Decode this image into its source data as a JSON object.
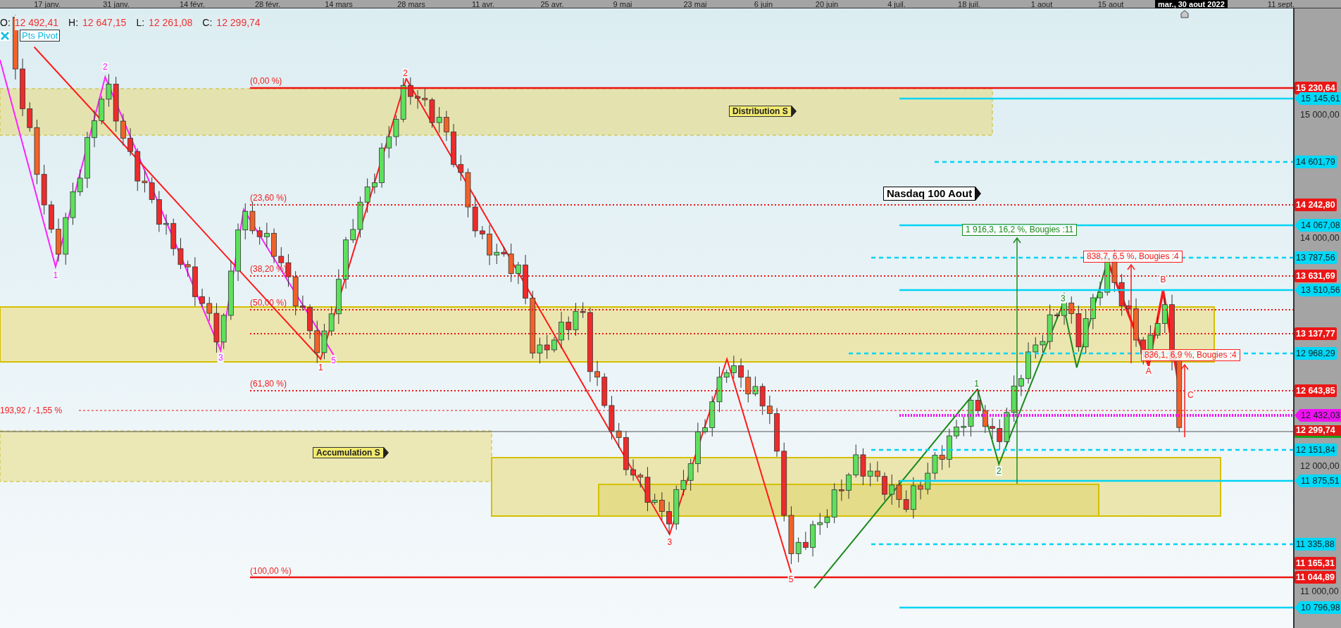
{
  "date_axis": {
    "labels": [
      "17 janv.",
      "31 janv.",
      "14 févr.",
      "28 févr.",
      "14 mars",
      "28 mars",
      "11 avr.",
      "25 avr.",
      "9 mai",
      "23 mai",
      "6 juin",
      "20 juin",
      "4 juil.",
      "18 juil.",
      "1 aout",
      "15 aout",
      "11 sept."
    ],
    "cursor_date": "mar., 30 aout 2022"
  },
  "legend": [
    {
      "key": "O:",
      "value": "12 492,41"
    },
    {
      "key": "H:",
      "value": "12 647,15"
    },
    {
      "key": "L:",
      "value": "12 261,08"
    },
    {
      "key": "C:",
      "value": "12 299,74"
    }
  ],
  "indicator": {
    "label": "Pts Pivot"
  },
  "chart_title": "Nasdaq 100 Aout",
  "zones": [
    {
      "label": "Distribution S"
    },
    {
      "label": "Accumulation S"
    }
  ],
  "fib_levels": [
    "(0,00 %)",
    "(23,60 %)",
    "(38,20 %)",
    "(50,00 %)",
    "(61,80 %)",
    "(100,00 %)"
  ],
  "range_label": "193,92 / -1,55 %",
  "waves": [
    {
      "color": "#ff20ff",
      "labels": [
        "1",
        "2",
        "3",
        "5"
      ]
    },
    {
      "color": "#ff1a1a",
      "labels": [
        "1",
        "2",
        "3",
        "5"
      ]
    },
    {
      "color": "#1a8a1a",
      "labels": [
        "1",
        "2",
        "3"
      ]
    },
    {
      "color": "#ff1a1a",
      "labels": [
        "A",
        "B",
        "C"
      ]
    }
  ],
  "measurements": [
    {
      "text": "1 916,3, 16,2 %, Bougies :11",
      "color": "#1a8a1a"
    },
    {
      "text": "838,7, 6,5 %, Bougies :4",
      "color": "#ff1a1a"
    },
    {
      "text": "836,1, 6,9 %, Bougies :4",
      "color": "#ff1a1a"
    }
  ],
  "price_axis": [
    {
      "text": "15 230,64",
      "kind": "red"
    },
    {
      "text": "15 145,61",
      "kind": "line"
    },
    {
      "text": "15 000,00",
      "kind": "tick"
    },
    {
      "text": "14 601,79",
      "kind": "dashed"
    },
    {
      "text": "14 242,80",
      "kind": "red"
    },
    {
      "text": "14 067,08",
      "kind": "line"
    },
    {
      "text": "14 000,00",
      "kind": "tick"
    },
    {
      "text": "13 787,56",
      "kind": "dashed"
    },
    {
      "text": "13 631,69",
      "kind": "red"
    },
    {
      "text": "13 510,56",
      "kind": "line"
    },
    {
      "text": "13 137,77",
      "kind": "red"
    },
    {
      "text": "12 968,29",
      "kind": "dashed"
    },
    {
      "text": "12 643,85",
      "kind": "red"
    },
    {
      "text": "12 432,03",
      "kind": "pivot"
    },
    {
      "text": "12 299,74",
      "kind": "last"
    },
    {
      "text": "12 151,84",
      "kind": "dashed"
    },
    {
      "text": "12 000,00",
      "kind": "tick"
    },
    {
      "text": "11 875,51",
      "kind": "line"
    },
    {
      "text": "11 335,88",
      "kind": "dashed"
    },
    {
      "text": "11 165,31",
      "kind": "red"
    },
    {
      "text": "11 044,89",
      "kind": "red"
    },
    {
      "text": "11 000,00",
      "kind": "tick"
    },
    {
      "text": "10 796,98",
      "kind": "line"
    }
  ]
}
